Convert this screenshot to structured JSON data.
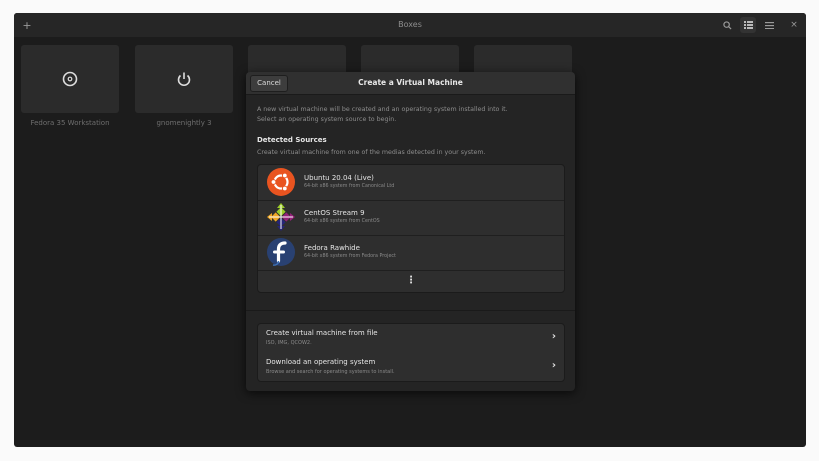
{
  "headerbar": {
    "title": "Boxes",
    "new_icon": "plus-icon",
    "search_icon": "search-icon",
    "view_icon": "grid-view-icon",
    "menu_icon": "hamburger-menu-icon",
    "close_icon": "close-icon"
  },
  "machines": [
    {
      "label": "Fedora 35 Workstation",
      "icon": "disc-icon"
    },
    {
      "label": "gnomenightly 3",
      "icon": "power-icon"
    },
    {
      "label": ""
    },
    {
      "label": ""
    },
    {
      "label": ""
    }
  ],
  "dialog": {
    "title": "Create a Virtual Machine",
    "cancel_label": "Cancel",
    "intro_line1": "A new virtual machine will be created and an operating system installed into it.",
    "intro_line2": "Select an operating system source to begin.",
    "detected_title": "Detected Sources",
    "detected_sub": "Create virtual machine from one of the medias detected in your system.",
    "sources": [
      {
        "name": "Ubuntu 20.04 (Live)",
        "desc": "64-bit x86 system from Canonical Ltd",
        "icon": "ubuntu-logo-icon"
      },
      {
        "name": "CentOS Stream 9",
        "desc": "64-bit x86 system from CentOS",
        "icon": "centos-logo-icon"
      },
      {
        "name": "Fedora Rawhide",
        "desc": "64-bit x86 system from Fedora Project",
        "icon": "fedora-logo-icon"
      }
    ],
    "more_label": "⋮",
    "actions": [
      {
        "title": "Create virtual machine from file",
        "sub": "ISO, IMG, QCOW2.",
        "chevron": "›"
      },
      {
        "title": "Download an operating system",
        "sub": "Browse and search for operating systems to install.",
        "chevron": "›"
      }
    ]
  },
  "colors": {
    "window_bg": "#1c1c1c",
    "dialog_bg": "#242424",
    "list_bg": "#2e2e2e",
    "ubuntu_orange": "#e95420",
    "fedora_blue": "#294172"
  }
}
